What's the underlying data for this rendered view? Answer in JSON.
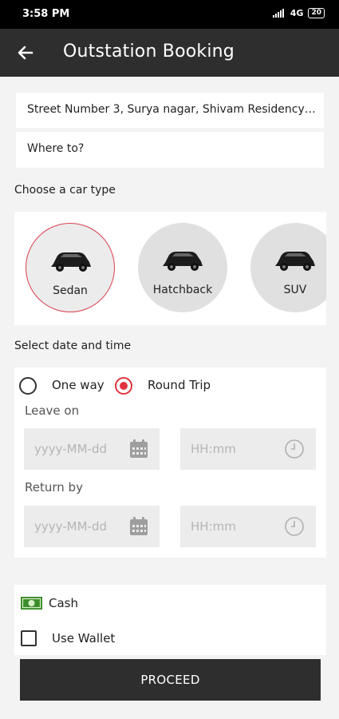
{
  "status_bar": {
    "time": "3:58 PM",
    "network": "4G",
    "battery": "20"
  },
  "header": {
    "title": "Outstation Booking"
  },
  "locations": {
    "pickup": "Street Number 3, Surya nagar, Shivam Residency, S...",
    "destination_placeholder": "Where to?"
  },
  "car_section": {
    "label": "Choose a car type",
    "cars": [
      {
        "label": "Sedan",
        "selected": true
      },
      {
        "label": "Hatchback",
        "selected": false
      },
      {
        "label": "SUV",
        "selected": false
      }
    ]
  },
  "schedule": {
    "label": "Select date and time",
    "trip_types": [
      {
        "label": "One way",
        "selected": false
      },
      {
        "label": "Round Trip",
        "selected": true
      }
    ],
    "leave_label": "Leave on",
    "return_label": "Return by",
    "date_placeholder": "yyyy-MM-dd",
    "time_placeholder": "HH:mm"
  },
  "payment": {
    "cash_label": "Cash",
    "wallet_label": "Use Wallet"
  },
  "proceed_label": "PROCEED",
  "colors": {
    "accent": "#e0333f",
    "appbar": "#2e2e2e",
    "cash_icon": "#3a8c2a"
  }
}
